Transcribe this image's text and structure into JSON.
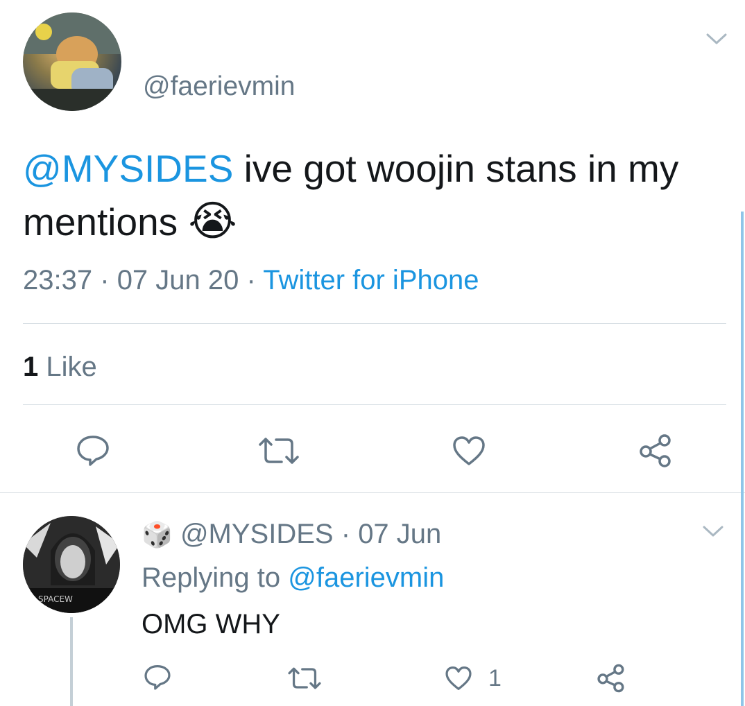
{
  "main_tweet": {
    "handle": "@faerievmin",
    "mention": "@MYSIDES",
    "text": "ive got woojin stans in my mentions",
    "emoji": "😭",
    "time": "23:37",
    "date": "07 Jun 20",
    "source": "Twitter for iPhone",
    "likes_count": "1",
    "likes_label": "Like",
    "separator": "·"
  },
  "reply": {
    "badge_emoji": "🎲",
    "handle": "@MYSIDES",
    "date": "07 Jun",
    "replying_to_label": "Replying to",
    "replying_to_handle": "@faerievmin",
    "text": "OMG WHY",
    "like_count": "1",
    "separator": "·"
  },
  "colors": {
    "accent": "#1b95e0",
    "muted": "#657786",
    "icon": "#657786",
    "divider": "#d8dfe4",
    "thread_line": "#c4cfd6",
    "scrollbar": "#8fc5e8"
  },
  "icons": {
    "menu": "chevron-down-icon",
    "reply": "reply-icon",
    "retweet": "retweet-icon",
    "like": "heart-icon",
    "share": "share-icon"
  }
}
